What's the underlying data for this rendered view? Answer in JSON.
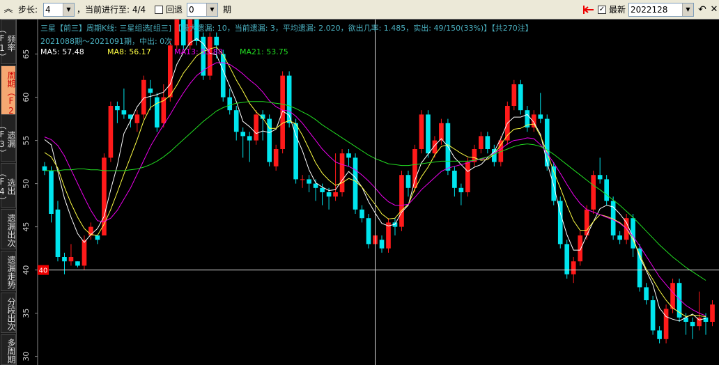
{
  "toolbar": {
    "step_label": "步长:",
    "step_value": "4",
    "progress_label": "，当前进行至: 4/4",
    "review_label": "回退",
    "review_value": "0",
    "period_unit": "期",
    "latest_label": "最新",
    "latest_value": "2022128",
    "latest_checked": "✓"
  },
  "sidebar": {
    "tabs": [
      {
        "label": "频率（F1）"
      },
      {
        "label": "周期（F2）"
      },
      {
        "label": "遗漏（F3）"
      },
      {
        "label": "选出（F4）"
      },
      {
        "label": "遗漏出次"
      },
      {
        "label": "遗漏走势"
      },
      {
        "label": "分段出次"
      },
      {
        "label": "多周期"
      }
    ]
  },
  "chart_header": {
    "line1": "三星【前三】周期K线: 三星组选[组三] 【最大遗漏: 10，当前遗漏: 3，平均遗漏: 2.020，欲出几率: 1.485，实出: 49/150(33%)】【共270注】",
    "line2": "2021088期～2021091期，中出: 0次",
    "ma5": "MA5: 57.48",
    "ma8": "MA8: 56.17",
    "ma13": "MA13: 53.88",
    "ma21": "MA21: 53.75",
    "crosshair_label": "40"
  },
  "colors": {
    "up": "#ff1a1a",
    "down": "#00e5ee",
    "ma5": "#ffffff",
    "ma8": "#ffff44",
    "ma13": "#ee00ee",
    "ma21": "#22dd22",
    "header_text": "#4ab0c0"
  },
  "chart_data": {
    "type": "candlestick",
    "title": "三星【前三】周期K线: 三星组选[组三]",
    "ylim": [
      29,
      69
    ],
    "yticks": [
      30,
      35,
      40,
      45,
      50,
      55,
      60,
      65
    ],
    "crosshair": {
      "y": 40,
      "candle_index": 50
    },
    "candles": [
      [
        52,
        51.5,
        52.5,
        51
      ],
      [
        51.5,
        46.5,
        52,
        45.5
      ],
      [
        47,
        41.5,
        48,
        41
      ],
      [
        41.5,
        41,
        42,
        39.5
      ],
      [
        41,
        41.5,
        43,
        40.5
      ],
      [
        41,
        40.5,
        41,
        40.3
      ],
      [
        40.5,
        43.5,
        44,
        40
      ],
      [
        44,
        45,
        45.5,
        43.5
      ],
      [
        44,
        43.5,
        44,
        43
      ],
      [
        44,
        53,
        53.5,
        44
      ],
      [
        53,
        59,
        59.5,
        52.5
      ],
      [
        59,
        58.5,
        59.5,
        57
      ],
      [
        58.5,
        58,
        61,
        57.5
      ],
      [
        58,
        57.5,
        58,
        56.5
      ],
      [
        57,
        58,
        58.5,
        56
      ],
      [
        58,
        62,
        62.5,
        57.5
      ],
      [
        61,
        60.5,
        62,
        58.5
      ],
      [
        60,
        56.5,
        60.5,
        56
      ],
      [
        57,
        60,
        61.5,
        56.5
      ],
      [
        60,
        66,
        66.5,
        59.5
      ],
      [
        66,
        69,
        69,
        65.5
      ],
      [
        69,
        66,
        70,
        65.5
      ],
      [
        66,
        70,
        70,
        65.5
      ],
      [
        69,
        66.5,
        69.5,
        66
      ],
      [
        67,
        62.5,
        67.5,
        62
      ],
      [
        62.5,
        67,
        67.5,
        62
      ],
      [
        67,
        66,
        67.5,
        64.5
      ],
      [
        65,
        60,
        65.5,
        59.5
      ],
      [
        60,
        58.5,
        61,
        58
      ],
      [
        58.5,
        56,
        59,
        55
      ],
      [
        56,
        55.5,
        56.5,
        53
      ],
      [
        55.5,
        55,
        56,
        52.5
      ],
      [
        55,
        58,
        58.5,
        54.5
      ],
      [
        58,
        57.5,
        58.5,
        55
      ],
      [
        57.5,
        52.5,
        58,
        52
      ],
      [
        52,
        54,
        54.5,
        51.5
      ],
      [
        54,
        62.5,
        63,
        53.5
      ],
      [
        62.5,
        57,
        63,
        56.5
      ],
      [
        57,
        50.5,
        57.5,
        50
      ],
      [
        50.5,
        50.5,
        51,
        49.5
      ],
      [
        50.5,
        50,
        51,
        49
      ],
      [
        50,
        49.5,
        50.5,
        48
      ],
      [
        49.5,
        49,
        50,
        47.5
      ],
      [
        49,
        48.5,
        49.5,
        47
      ],
      [
        48.5,
        49,
        53.5,
        48
      ],
      [
        49,
        53.5,
        54,
        48.5
      ],
      [
        53.5,
        53,
        54,
        52
      ],
      [
        53,
        47,
        53.5,
        46.5
      ],
      [
        47,
        46,
        47.5,
        45.5
      ],
      [
        46,
        43,
        46.5,
        42.5
      ],
      [
        43,
        44,
        45.5,
        42.5
      ],
      [
        43.5,
        42.5,
        44,
        42
      ],
      [
        42.5,
        45.5,
        46,
        42
      ],
      [
        45.5,
        45,
        46,
        44
      ],
      [
        45,
        51,
        51.5,
        44.5
      ],
      [
        51,
        49.5,
        51.5,
        48.5
      ],
      [
        49.5,
        54,
        54.5,
        49
      ],
      [
        54,
        58,
        58.5,
        53.5
      ],
      [
        58,
        53.5,
        58.5,
        53
      ],
      [
        53.5,
        55,
        55.5,
        53
      ],
      [
        55,
        57,
        57.5,
        54.5
      ],
      [
        57,
        51.5,
        57.5,
        51
      ],
      [
        51.5,
        49.5,
        52,
        48.5
      ],
      [
        49.5,
        49,
        50,
        47.5
      ],
      [
        49,
        52.5,
        53,
        48.5
      ],
      [
        52.5,
        54,
        54.5,
        52
      ],
      [
        54,
        55.5,
        56,
        53.5
      ],
      [
        55.5,
        54,
        56,
        53.5
      ],
      [
        54,
        52.5,
        54.5,
        52
      ],
      [
        52.5,
        55,
        55.5,
        52
      ],
      [
        55,
        59,
        59.5,
        54.5
      ],
      [
        59,
        61.5,
        62,
        58.5
      ],
      [
        61.5,
        58.5,
        62,
        58
      ],
      [
        58.5,
        56.5,
        59,
        56
      ],
      [
        56.5,
        58,
        58.5,
        56
      ],
      [
        58,
        57.5,
        60.5,
        57
      ],
      [
        57.5,
        52,
        58,
        51.5
      ],
      [
        52,
        48,
        52.5,
        47.5
      ],
      [
        48,
        43,
        48.5,
        42.5
      ],
      [
        43,
        39.5,
        43.5,
        39
      ],
      [
        39.5,
        41,
        41.5,
        38.5
      ],
      [
        41,
        44,
        44.5,
        40.5
      ],
      [
        44,
        47,
        47.5,
        43.5
      ],
      [
        47,
        51,
        51.5,
        46.5
      ],
      [
        51,
        50.5,
        53,
        50
      ],
      [
        50.5,
        48,
        51,
        47.5
      ],
      [
        48,
        44,
        48.5,
        43.5
      ],
      [
        44,
        43.5,
        44.5,
        43
      ],
      [
        43.5,
        46,
        46.5,
        43
      ],
      [
        46,
        42.5,
        46.5,
        41.5
      ],
      [
        42.5,
        38,
        43,
        37.5
      ],
      [
        38,
        36.5,
        38.5,
        36
      ],
      [
        36.5,
        33,
        37,
        32.5
      ],
      [
        33,
        32,
        33.5,
        31.5
      ],
      [
        32,
        35.5,
        36,
        31.5
      ],
      [
        35.5,
        38.5,
        39,
        35
      ],
      [
        38.5,
        34.5,
        39,
        34
      ],
      [
        34.5,
        34,
        35,
        32.5
      ],
      [
        34,
        33.5,
        34.5,
        32
      ],
      [
        33.5,
        34.5,
        37.5,
        33
      ],
      [
        34.5,
        34,
        35,
        32.5
      ],
      [
        34,
        36,
        36.5,
        33.5
      ]
    ],
    "ma5": [
      55.1,
      54.5,
      51.4,
      48.3,
      46.1,
      44.2,
      43.2,
      44.1,
      44.8,
      46.2,
      49.3,
      52.1,
      55.8,
      57.3,
      58.9,
      59.9,
      60.1,
      60.3,
      60.6,
      61.5,
      63.8,
      65.2,
      66.3,
      66.8,
      66.2,
      65.1,
      64.9,
      63.1,
      61.3,
      59.5,
      57.2,
      56.6,
      55.8,
      56.1,
      55.9,
      56.3,
      58.4,
      57.9,
      55.6,
      53.8,
      51.6,
      50.1,
      49.6,
      49.2,
      49.3,
      50.4,
      51.4,
      50.7,
      49.6,
      47.9,
      46.6,
      45.4,
      45.1,
      45.3,
      46.7,
      47.5,
      50.4,
      52.4,
      53.4,
      54.4,
      55.2,
      54.3,
      53.0,
      52.2,
      51.4,
      51.9,
      52.2,
      53.0,
      53.7,
      55.2,
      57.0,
      57.7,
      57.7,
      58.0,
      57.1,
      55.7,
      52.4,
      49.8,
      46.6,
      44.1,
      42.3,
      42.3,
      44.0,
      45.6,
      47.1,
      47.5,
      47.3,
      46.5,
      45.5,
      43.8,
      41.5,
      39.9,
      38.3,
      35.6,
      34.6,
      34.3,
      34.1,
      34.5,
      34.9,
      34.2,
      34.4
    ],
    "ma8": [
      53.6,
      53.1,
      51.8,
      49.6,
      47.7,
      46.1,
      44.8,
      44.1,
      44.0,
      45.3,
      47.0,
      49.0,
      51.1,
      53.1,
      55.1,
      57.3,
      58.8,
      59.3,
      59.6,
      60.2,
      61.4,
      62.8,
      63.8,
      64.8,
      65.3,
      65.6,
      65.8,
      64.9,
      63.5,
      62.0,
      60.7,
      59.3,
      58.3,
      57.6,
      56.4,
      56.4,
      57.0,
      57.3,
      56.9,
      55.6,
      54.0,
      52.4,
      51.2,
      50.4,
      49.8,
      50.1,
      50.6,
      50.3,
      49.6,
      48.6,
      47.6,
      46.5,
      45.9,
      46.0,
      46.9,
      47.6,
      49.4,
      50.8,
      51.9,
      53.3,
      54.3,
      54.5,
      54.0,
      53.5,
      53.1,
      53.0,
      52.7,
      52.8,
      53.4,
      54.5,
      55.6,
      56.3,
      56.4,
      56.8,
      56.9,
      55.5,
      53.6,
      51.4,
      49.5,
      47.5,
      45.7,
      44.6,
      44.6,
      45.6,
      46.4,
      46.2,
      45.9,
      45.5,
      44.8,
      43.5,
      41.8,
      40.1,
      38.9,
      37.6,
      36.5,
      35.6,
      35.1,
      34.6,
      34.8,
      34.7,
      34.6
    ],
    "ma13": [
      55.4,
      55.1,
      54.4,
      53.2,
      51.6,
      50.0,
      48.4,
      46.9,
      45.7,
      45.6,
      46.0,
      46.9,
      48.2,
      49.5,
      51.1,
      52.7,
      54.3,
      55.6,
      56.8,
      58.0,
      59.3,
      60.5,
      61.6,
      62.5,
      63.1,
      63.6,
      64.0,
      64.0,
      63.8,
      63.3,
      62.7,
      62.0,
      61.4,
      60.6,
      59.6,
      58.9,
      58.5,
      58.4,
      57.8,
      57.0,
      56.0,
      55.0,
      54.0,
      53.2,
      52.5,
      52.2,
      52.0,
      51.6,
      51.0,
      50.3,
      49.5,
      48.6,
      47.9,
      47.5,
      47.5,
      47.6,
      48.4,
      49.3,
      50.0,
      50.7,
      51.4,
      51.8,
      52.0,
      52.2,
      52.4,
      52.7,
      52.8,
      53.1,
      53.5,
      54.0,
      54.6,
      55.0,
      55.1,
      55.3,
      55.2,
      54.5,
      53.5,
      52.4,
      51.2,
      49.9,
      48.7,
      47.7,
      47.0,
      46.7,
      46.4,
      46.1,
      45.8,
      45.4,
      44.8,
      43.9,
      42.8,
      41.6,
      40.4,
      39.2,
      38.3,
      37.4,
      36.6,
      35.9,
      35.4,
      35.0,
      34.7
    ],
    "ma21": [
      51.5,
      51.5,
      51.5,
      51.6,
      51.6,
      51.7,
      51.7,
      51.6,
      51.6,
      51.5,
      51.5,
      51.5,
      51.5,
      51.6,
      51.7,
      51.9,
      52.2,
      52.6,
      53.1,
      53.7,
      54.4,
      55.1,
      55.8,
      56.5,
      57.2,
      57.8,
      58.4,
      58.8,
      59.1,
      59.3,
      59.4,
      59.5,
      59.5,
      59.5,
      59.4,
      59.3,
      59.2,
      59.0,
      58.7,
      58.3,
      57.9,
      57.4,
      56.8,
      56.3,
      55.8,
      55.3,
      54.8,
      54.3,
      53.8,
      53.3,
      52.9,
      52.6,
      52.3,
      52.2,
      52.1,
      52.1,
      52.2,
      52.3,
      52.4,
      52.5,
      52.6,
      52.6,
      52.6,
      52.6,
      52.6,
      52.7,
      52.9,
      53.1,
      53.4,
      53.7,
      54.0,
      54.3,
      54.5,
      54.6,
      54.5,
      54.3,
      53.9,
      53.4,
      52.8,
      52.2,
      51.6,
      51.0,
      50.4,
      49.8,
      49.3,
      48.7,
      48.1,
      47.5,
      46.8,
      46.1,
      45.3,
      44.5,
      43.7,
      42.9,
      42.2,
      41.5,
      40.9,
      40.3,
      39.8,
      39.3,
      38.8
    ]
  }
}
